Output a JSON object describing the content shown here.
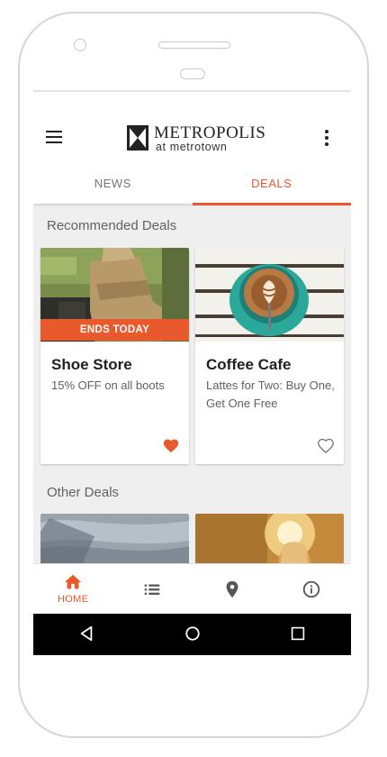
{
  "header": {
    "brand_name": "METROPOLIS",
    "brand_sub": "at metrotown"
  },
  "tabs": [
    {
      "label": "NEWS",
      "active": false
    },
    {
      "label": "DEALS",
      "active": true
    }
  ],
  "recommended": {
    "title": "Recommended Deals",
    "cards": [
      {
        "badge": "ENDS TODAY",
        "title": "Shoe Store",
        "description": "15% OFF on all boots",
        "favorited": true,
        "image": "boots-photo"
      },
      {
        "badge": "",
        "title": "Coffee Cafe",
        "description": "Lattes for Two: Buy One, Get One Free",
        "favorited": false,
        "image": "latte-photo"
      }
    ]
  },
  "other": {
    "title": "Other Deals",
    "cards": [
      {
        "image": "denim-photo"
      },
      {
        "image": "sunset-portrait-photo"
      }
    ]
  },
  "bottom_nav": {
    "items": [
      {
        "icon": "home-icon",
        "label": "HOME",
        "active": true
      },
      {
        "icon": "list-icon",
        "label": "",
        "active": false
      },
      {
        "icon": "location-pin-icon",
        "label": "",
        "active": false
      },
      {
        "icon": "info-icon",
        "label": "",
        "active": false
      }
    ]
  },
  "system_nav": [
    "back-icon",
    "home-circle-icon",
    "recents-icon"
  ],
  "colors": {
    "accent": "#e85a2c",
    "background": "#efefef",
    "card": "#ffffff",
    "system_bar": "#000000"
  }
}
